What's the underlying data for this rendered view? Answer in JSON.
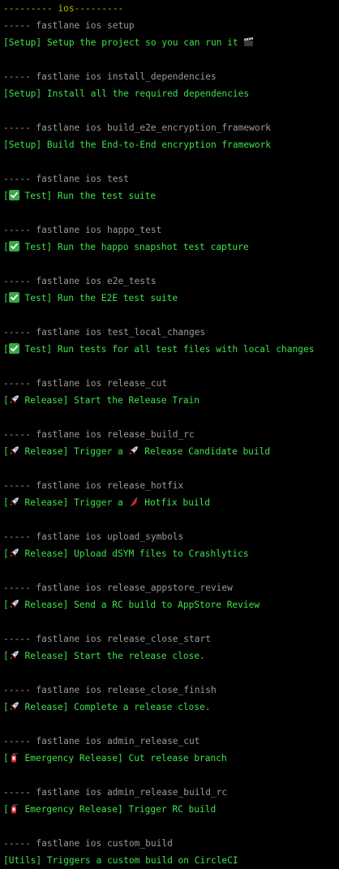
{
  "header": "--------- ios---------",
  "commands": [
    {
      "lane": "----- fastlane ios setup",
      "prefix": "[Setup] ",
      "icon": "",
      "text": "Setup the project so you can run it",
      "trail_icon": "clapper-board-icon",
      "mid_icon": "",
      "after_mid": ""
    },
    {
      "lane": "----- fastlane ios install_dependencies",
      "prefix": "[Setup] ",
      "icon": "",
      "text": "Install all the required dependencies",
      "trail_icon": "",
      "mid_icon": "",
      "after_mid": ""
    },
    {
      "lane": "----- fastlane ios build_e2e_encryption_framework",
      "prefix": "[Setup] ",
      "icon": "",
      "text": "Build the End-to-End encryption framework",
      "trail_icon": "",
      "mid_icon": "",
      "after_mid": ""
    },
    {
      "lane": "----- fastlane ios test",
      "prefix": "[",
      "icon": "check-mark-icon",
      "text": " Test] Run the test suite",
      "trail_icon": "",
      "mid_icon": "",
      "after_mid": ""
    },
    {
      "lane": "----- fastlane ios happo_test",
      "prefix": "[",
      "icon": "check-mark-icon",
      "text": " Test] Run the happo snapshot test capture",
      "trail_icon": "",
      "mid_icon": "",
      "after_mid": ""
    },
    {
      "lane": "----- fastlane ios e2e_tests",
      "prefix": "[",
      "icon": "check-mark-icon",
      "text": " Test] Run the E2E test suite",
      "trail_icon": "",
      "mid_icon": "",
      "after_mid": ""
    },
    {
      "lane": "----- fastlane ios test_local_changes",
      "prefix": "[",
      "icon": "check-mark-icon",
      "text": " Test] Run tests for all test files with local changes",
      "trail_icon": "",
      "mid_icon": "",
      "after_mid": ""
    },
    {
      "lane": "----- fastlane ios release_cut",
      "prefix": "[",
      "icon": "rocket-icon",
      "text": " Release] Start the Release Train",
      "trail_icon": "",
      "mid_icon": "",
      "after_mid": ""
    },
    {
      "lane": "----- fastlane ios release_build_rc",
      "prefix": "[",
      "icon": "rocket-icon",
      "text": " Release] Trigger a ",
      "trail_icon": "",
      "mid_icon": "rocket-icon",
      "after_mid": " Release Candidate build"
    },
    {
      "lane": "----- fastlane ios release_hotfix",
      "prefix": "[",
      "icon": "rocket-icon",
      "text": " Release] Trigger a ",
      "trail_icon": "",
      "mid_icon": "hot-pepper-icon",
      "after_mid": " Hotfix build"
    },
    {
      "lane": "----- fastlane ios upload_symbols",
      "prefix": "[",
      "icon": "rocket-icon",
      "text": " Release] Upload dSYM files to Crashlytics",
      "trail_icon": "",
      "mid_icon": "",
      "after_mid": ""
    },
    {
      "lane": "----- fastlane ios release_appstore_review",
      "prefix": "[",
      "icon": "rocket-icon",
      "text": " Release] Send a RC build to AppStore Review",
      "trail_icon": "",
      "mid_icon": "",
      "after_mid": ""
    },
    {
      "lane": "----- fastlane ios release_close_start",
      "prefix": "[",
      "icon": "rocket-icon",
      "text": " Release] Start the release close.",
      "trail_icon": "",
      "mid_icon": "",
      "after_mid": ""
    },
    {
      "lane": "----- fastlane ios release_close_finish",
      "prefix": "[",
      "icon": "rocket-icon",
      "text": " Release] Complete a release close.",
      "trail_icon": "",
      "mid_icon": "",
      "after_mid": ""
    },
    {
      "lane": "----- fastlane ios admin_release_cut",
      "prefix": "[",
      "icon": "fire-extinguisher-icon",
      "text": " Emergency Release] Cut release branch",
      "trail_icon": "",
      "mid_icon": "",
      "after_mid": ""
    },
    {
      "lane": "----- fastlane ios admin_release_build_rc",
      "prefix": "[",
      "icon": "fire-extinguisher-icon",
      "text": " Emergency Release] Trigger RC build",
      "trail_icon": "",
      "mid_icon": "",
      "after_mid": ""
    },
    {
      "lane": "----- fastlane ios custom_build",
      "prefix": "[Utils] ",
      "icon": "",
      "text": "Triggers a custom build on CircleCI",
      "trail_icon": "",
      "mid_icon": "",
      "after_mid": ""
    }
  ],
  "colors": {
    "background": "#000000",
    "header": "#b8b400",
    "lane": "#9a9a9a",
    "description": "#3fe14c"
  }
}
